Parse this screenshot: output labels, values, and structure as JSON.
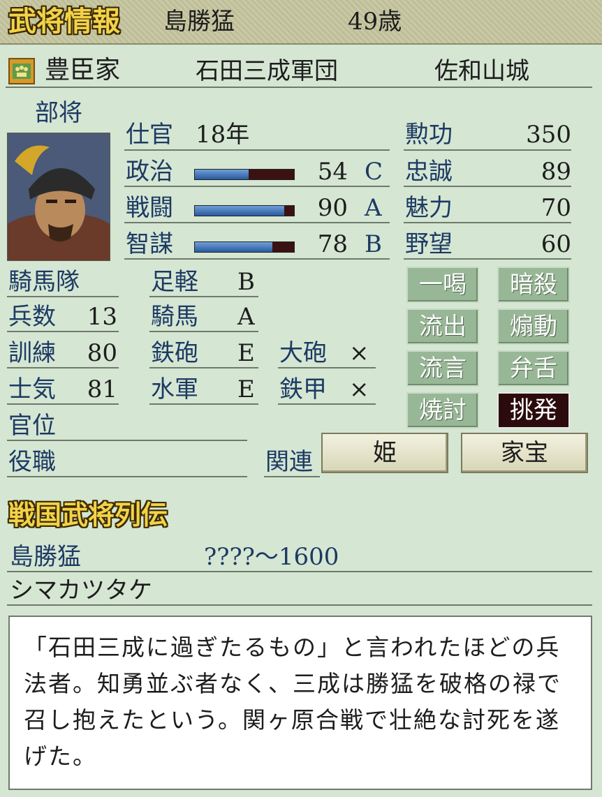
{
  "header": {
    "title": "武将情報",
    "name": "島勝猛",
    "age": "49歳"
  },
  "affiliation": {
    "clan": "豊臣家",
    "corps": "石田三成軍団",
    "castle": "佐和山城"
  },
  "rank": "部将",
  "service": {
    "label": "仕官",
    "value": "18年"
  },
  "stats": [
    {
      "label": "政治",
      "value": "54",
      "grade": "C",
      "ratio": 0.54
    },
    {
      "label": "戦闘",
      "value": "90",
      "grade": "A",
      "ratio": 0.9
    },
    {
      "label": "智謀",
      "value": "78",
      "grade": "B",
      "ratio": 0.78
    }
  ],
  "traits": [
    {
      "label": "勲功",
      "value": "350"
    },
    {
      "label": "忠誠",
      "value": "89"
    },
    {
      "label": "魅力",
      "value": "70"
    },
    {
      "label": "野望",
      "value": "60"
    }
  ],
  "unit": {
    "type": "騎馬隊",
    "rows": [
      {
        "label": "兵数",
        "value": "13"
      },
      {
        "label": "訓練",
        "value": "80"
      },
      {
        "label": "士気",
        "value": "81"
      }
    ]
  },
  "aptitudes": [
    {
      "label": "足軽",
      "grade": "B"
    },
    {
      "label": "騎馬",
      "grade": "A"
    },
    {
      "label": "鉄砲",
      "grade": "E"
    },
    {
      "label": "水軍",
      "grade": "E"
    }
  ],
  "equipment": [
    {
      "label": "大砲",
      "value": "×"
    },
    {
      "label": "鉄甲",
      "value": "×"
    }
  ],
  "titles": {
    "rank_label": "官位",
    "post_label": "役職"
  },
  "commands": [
    "一喝",
    "暗殺",
    "流出",
    "煽動",
    "流言",
    "弁舌",
    "焼討",
    "挑発"
  ],
  "related": {
    "label": "関連",
    "buttons": [
      "姫",
      "家宝"
    ]
  },
  "biography": {
    "heading": "戦国武将列伝",
    "name": "島勝猛",
    "years": "????～1600",
    "reading": "シマカツタケ",
    "text": "「石田三成に過ぎたるもの」と言われたほどの兵法者。知勇並ぶ者なく、三成は勝猛を破格の禄で召し抱えたという。関ヶ原合戦で壮絶な討死を遂げた。"
  }
}
